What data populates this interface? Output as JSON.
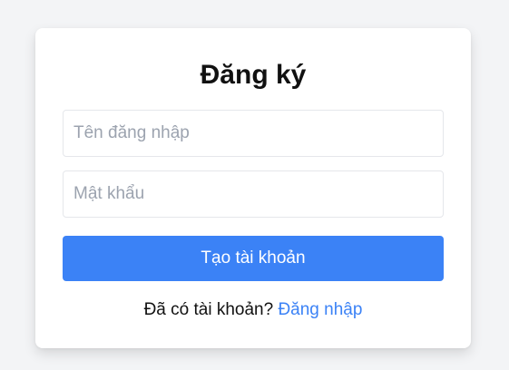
{
  "form": {
    "title": "Đăng ký",
    "username_placeholder": "Tên đăng nhập",
    "username_value": "",
    "password_placeholder": "Mật khẩu",
    "password_value": "",
    "submit_label": "Tạo tài khoản",
    "footer_text": "Đã có tài khoản?",
    "footer_link": "Đăng nhập"
  },
  "colors": {
    "background": "#f3f4f6",
    "card": "#ffffff",
    "accent": "#3b82f6",
    "placeholder": "#9ca3af"
  }
}
